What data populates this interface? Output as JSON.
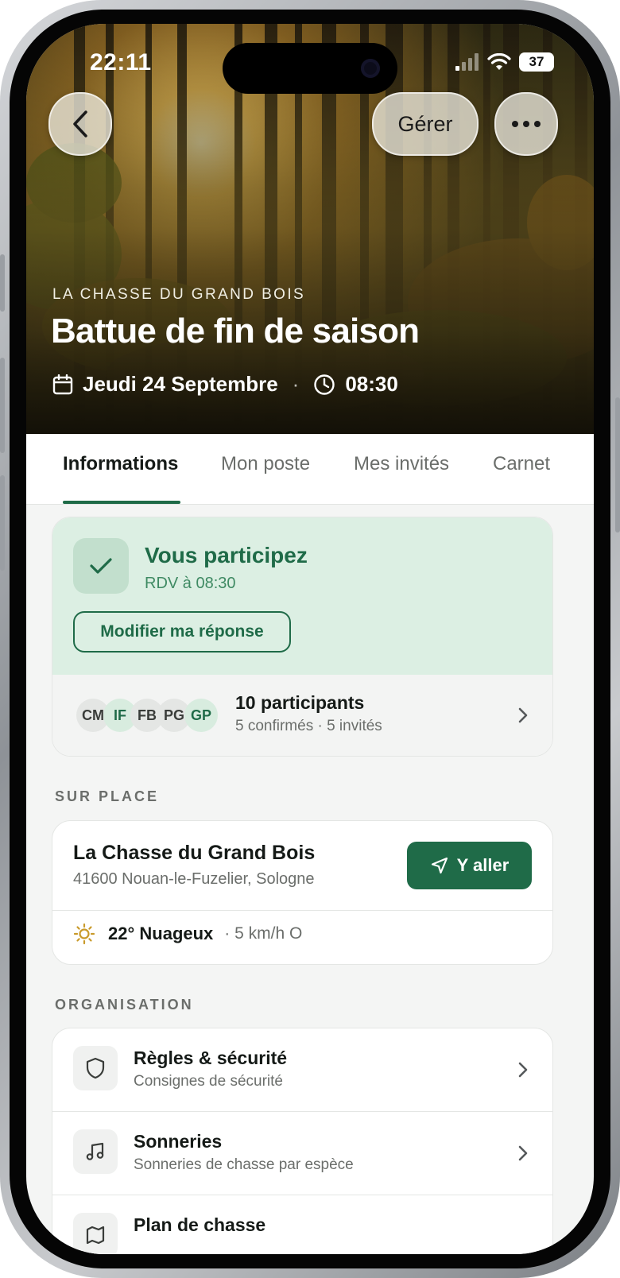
{
  "status_bar": {
    "time": "22:11",
    "battery": "37"
  },
  "nav": {
    "manage_label": "Gérer"
  },
  "event": {
    "club": "LA CHASSE DU GRAND BOIS",
    "title": "Battue de fin de saison",
    "date": "Jeudi 24 Septembre",
    "time": "08:30"
  },
  "tabs": [
    "Informations",
    "Mon poste",
    "Mes invités",
    "Carnet"
  ],
  "participation": {
    "title": "Vous participez",
    "subtitle": "RDV à 08:30",
    "modify_label": "Modifier ma réponse",
    "avatars": [
      "CM",
      "IF",
      "FB",
      "PG",
      "GP"
    ],
    "count_label": "10 participants",
    "detail": "5 confirmés · 5 invités"
  },
  "place": {
    "section_label": "SUR PLACE",
    "name": "La Chasse du Grand Bois",
    "address": "41600 Nouan-le-Fuzelier, Sologne",
    "go_label": "Y aller",
    "weather_temp": "22° Nuageux",
    "weather_wind": "· 5 km/h O"
  },
  "organisation": {
    "section_label": "ORGANISATION",
    "items": [
      {
        "title": "Règles & sécurité",
        "subtitle": "Consignes de sécurité",
        "icon": "shield-icon"
      },
      {
        "title": "Sonneries",
        "subtitle": "Sonneries de chasse par espèce",
        "icon": "music-note-icon"
      },
      {
        "title": "Plan de chasse",
        "subtitle": "",
        "icon": "map-icon"
      }
    ]
  },
  "colors": {
    "accent": "#1f6b48",
    "accent_light": "#dcefe3"
  }
}
